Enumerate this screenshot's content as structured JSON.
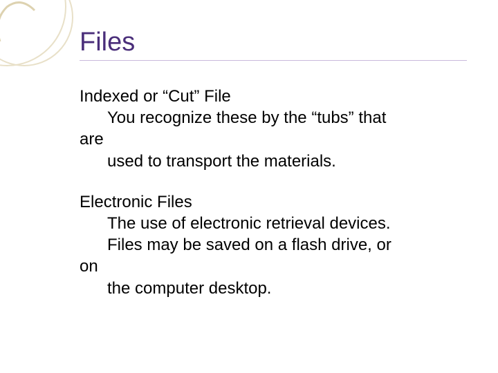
{
  "title": "Files",
  "section1": {
    "heading": "Indexed or “Cut” File",
    "line1": "You recognize these by the “tubs” that",
    "line2": "are",
    "line3": "used to transport the materials."
  },
  "section2": {
    "heading": "Electronic Files",
    "line1": "The use of electronic retrieval devices.",
    "line2": "Files may be saved on a flash drive, or",
    "line3": "on",
    "line4": "the computer desktop."
  }
}
